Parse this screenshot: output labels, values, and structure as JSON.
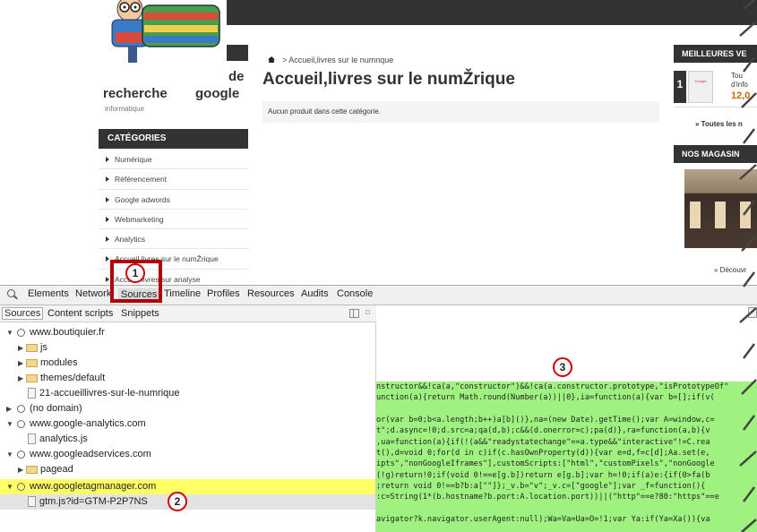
{
  "site": {
    "logo_suffix": "de",
    "brand_left": "recherche",
    "brand_right": "google",
    "brand_sub": "informatique",
    "breadcrumb": "> Accueil,livres sur le numnque",
    "page_title": "Accueil,livres sur le numŽrique",
    "notice": "Aucun produit dans cette catégorie.",
    "categories_title": "CATÉGORIES",
    "categories": [
      "Numérique",
      "Référencement",
      "Google adwords",
      "Webmarketing",
      "Analytics",
      "Accueil livres sur le numŽrique",
      "Accueil livres sur analyse"
    ],
    "bestsellers_title": "MEILLEURES VE",
    "bestseller": {
      "rank": "1",
      "line1": "Tou",
      "line2": "d'info",
      "price": "12,0",
      "book_label": "Google"
    },
    "all_link": "» Toutes les n",
    "stores_title": "NOS MAGASIN",
    "store_link": "» Découvr"
  },
  "devtools": {
    "tabs": [
      "Elements",
      "Network",
      "Sources",
      "Timeline",
      "Profiles",
      "Resources",
      "Audits",
      "Console"
    ],
    "active_tab": "Sources",
    "subtabs": [
      "Sources",
      "Content scripts",
      "Snippets"
    ],
    "tree": [
      {
        "label": "www.boutiquier.fr",
        "kind": "domain",
        "open": true
      },
      {
        "label": "js",
        "kind": "folder"
      },
      {
        "label": "modules",
        "kind": "folder"
      },
      {
        "label": "themes/default",
        "kind": "folder"
      },
      {
        "label": "21-accueillivres-sur-le-numrique",
        "kind": "file"
      },
      {
        "label": "(no domain)",
        "kind": "domain",
        "open": false
      },
      {
        "label": "www.google-analytics.com",
        "kind": "domain",
        "open": true
      },
      {
        "label": "analytics.js",
        "kind": "file"
      },
      {
        "label": "www.googleadservices.com",
        "kind": "domain",
        "open": true
      },
      {
        "label": "pagead",
        "kind": "folder"
      },
      {
        "label": "www.googletagmanager.com",
        "kind": "domain",
        "open": true
      },
      {
        "label": "gtm.js?id=GTM-P2P7NS",
        "kind": "file"
      }
    ],
    "code_lines": [
      "nstructor&&!ca(a,\"constructor\")&&!ca(a.constructor.prototype,\"isPrototypeOf\"",
      "unction(a){return Math.round(Number(a))||0},ia=function(a){var b=[];if(v(",
      "",
      "or(var b=0;b<a.length;b++)a[b]()},na=(new Date).getTime();var A=window,c=",
      "t\";d.async=!0;d.src=a;qa(d,b);c&&(d.onerror=c);pa(d)},ra=function(a,b){v",
      ",ua=function(a){if(!(a&&\"readystatechange\"==a.type&&\"interactive\"!=C.rea",
      "t(),d=void 0;for(d in c)if(c.hasOwnProperty(d)){var e=d,f=c[d];Aa.set(e,",
      "ipts\",\"nonGoogleIframes\"],customScripts:[\"html\",\"customPixels\",\"nonGoogle",
      "(!g)return!0;if(void 0!==e[g.b])return e[g.b];var h=!0;if(a)e:{if(0>fa(b",
      ";return void 0!==b?b:a[\"\"]};_v.b=\"v\";_v.c=[\"google\"];var _f=function(){",
      ":c=String(1*(b.hostname?b.port:A.location.port))||(\"http\"==e?80:\"https\"==e",
      "",
      "avigator?k.navigator.userAgent:null);Wa=Va=Ua=O=!1;var Ya:if(Ya=Xa()){va"
    ]
  },
  "annotations": [
    "1",
    "2",
    "3"
  ],
  "colors": {
    "highlight": "#ffff66",
    "code_bg": "#9ff27f",
    "annotation_red": "#b30000"
  }
}
